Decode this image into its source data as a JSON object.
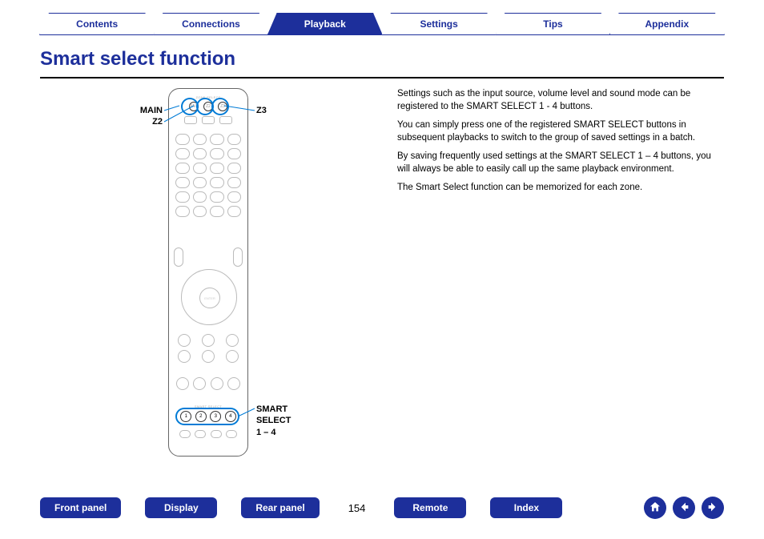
{
  "topnav": {
    "items": [
      {
        "label": "Contents",
        "active": false
      },
      {
        "label": "Connections",
        "active": false
      },
      {
        "label": "Playback",
        "active": true
      },
      {
        "label": "Settings",
        "active": false
      },
      {
        "label": "Tips",
        "active": false
      },
      {
        "label": "Appendix",
        "active": false
      }
    ]
  },
  "heading": "Smart select function",
  "callouts": {
    "main": "MAIN",
    "z2": "Z2",
    "z3": "Z3",
    "smart_select": "SMART\nSELECT\n1 – 4"
  },
  "remote": {
    "zone_select_label": "ZONE SELECT",
    "smart_select_label": "SMART SELECT",
    "zone_buttons": [
      "MAIN",
      "Z2",
      "Z3"
    ],
    "smart_select_buttons": [
      "1",
      "2",
      "3",
      "4"
    ]
  },
  "body_text": {
    "p1": "Settings such as the input source, volume level and sound mode can be registered to the SMART SELECT 1 - 4 buttons.",
    "p2": "You can simply press one of the registered SMART SELECT buttons in subsequent playbacks to switch to the group of saved settings in a batch.",
    "p3": "By saving frequently used settings at the SMART SELECT 1 – 4 buttons, you will always be able to easily call up the same playback environment.",
    "p4": "The Smart Select function can be memorized for each zone."
  },
  "bottomnav": {
    "front_panel": "Front panel",
    "display": "Display",
    "rear_panel": "Rear panel",
    "page": "154",
    "remote": "Remote",
    "index": "Index"
  },
  "accent_color": "#1d2f9b"
}
